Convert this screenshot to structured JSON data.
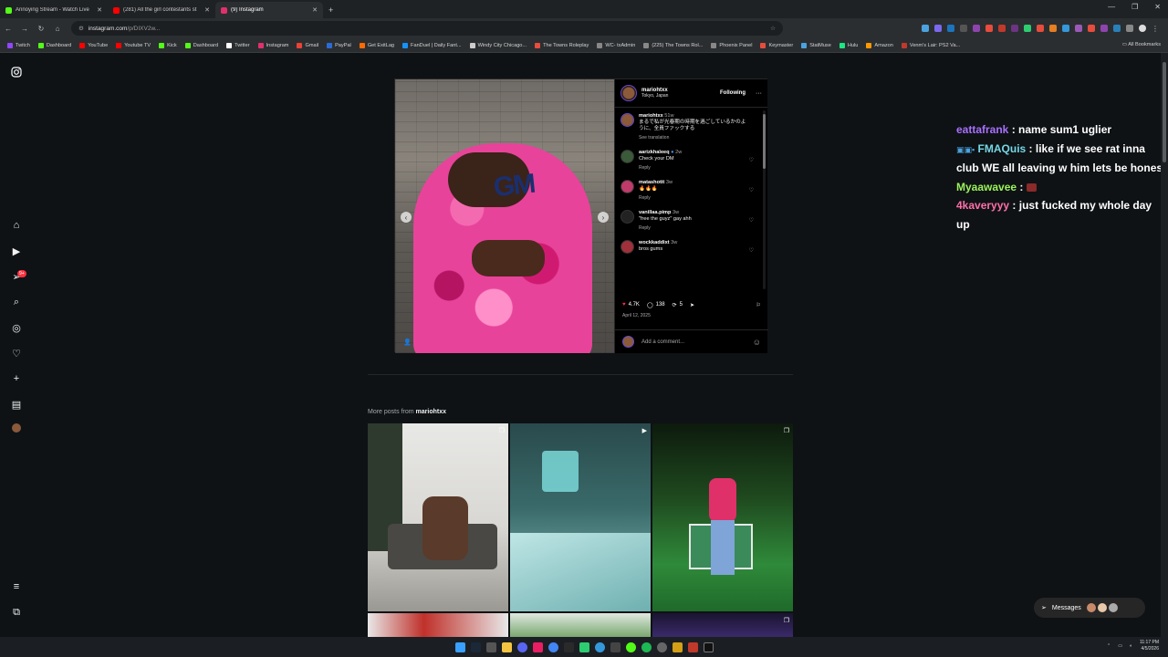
{
  "browser": {
    "tabs": [
      {
        "title": "Annoying Stream - Watch Live",
        "color": "#53fc18"
      },
      {
        "title": "(281) All the girl contestants st",
        "color": "#ff0000"
      },
      {
        "title": "(9) Instagram",
        "color": "#e1306c"
      }
    ],
    "url_host": "instagram.com",
    "url_path": "/p/DIXV2w..."
  },
  "bookmarks": [
    {
      "label": "Twitch",
      "color": "#9146ff"
    },
    {
      "label": "Dashboard",
      "color": "#53fc18"
    },
    {
      "label": "YouTube",
      "color": "#ff0000"
    },
    {
      "label": "Youtube TV",
      "color": "#ff0000"
    },
    {
      "label": "Kick",
      "color": "#53fc18"
    },
    {
      "label": "Dashboard",
      "color": "#53fc18"
    },
    {
      "label": "Twitter",
      "color": "#ffffff"
    },
    {
      "label": "Instagram",
      "color": "#e1306c"
    },
    {
      "label": "Gmail",
      "color": "#ea4335"
    },
    {
      "label": "PayPal",
      "color": "#2b6bd8"
    },
    {
      "label": "Get ExitLag",
      "color": "#ff6a00"
    },
    {
      "label": "FanDuel | Daily Fant...",
      "color": "#1493ff"
    },
    {
      "label": "Windy City Chicago...",
      "color": "#cccccc"
    },
    {
      "label": "The Towns Roleplay",
      "color": "#e74c3c"
    },
    {
      "label": "WC- txAdmin",
      "color": "#888888"
    },
    {
      "label": "(225) The Towns Rol...",
      "color": "#888888"
    },
    {
      "label": "Phoenix Panel",
      "color": "#888888"
    },
    {
      "label": "Keymaster",
      "color": "#e74c3c"
    },
    {
      "label": "StatMuse",
      "color": "#4aa3df"
    },
    {
      "label": "Hulu",
      "color": "#1ce783"
    },
    {
      "label": "Amazon",
      "color": "#ff9900"
    },
    {
      "label": "Venm's Lair: PS2 Va...",
      "color": "#c0392b"
    }
  ],
  "all_bookmarks": "All Bookmarks",
  "sidebar": {
    "notification_count": "9+"
  },
  "post": {
    "username": "mariohtxx",
    "location": "Tokyo, Japan",
    "follow_label": "Following",
    "caption_user": "mariohtxx",
    "caption_age": "51w",
    "caption_text": "まるで私が光春期の時期を過ごしているかのように、全員ファックする",
    "see_translation": "See translation",
    "comments": [
      {
        "user": "aarizkhaleeq",
        "age": "2w",
        "text": "Check your DM"
      },
      {
        "user": "matashotit",
        "age": "3w",
        "text": "🔥🔥🔥"
      },
      {
        "user": "vanillaa.pimp",
        "age": "3w",
        "text": "\"free the guyz\" gay ahh"
      },
      {
        "user": "wockkaddixt",
        "age": "3w",
        "text": "bros gums"
      }
    ],
    "reply_label": "Reply",
    "likes": "4.7K",
    "comments_count": "138",
    "reposts": "5",
    "date": "April 12, 2025",
    "add_comment_placeholder": "Add a comment..."
  },
  "more_posts": {
    "prefix": "More posts from",
    "user": "mariohtxx"
  },
  "chat": [
    {
      "name": "eattafrank",
      "text": "name sum1 uglier"
    },
    {
      "name": "FMAQuis",
      "text": "like if we see rat inna club WE all leaving w him lets be honest"
    },
    {
      "name": "Myaawavee",
      "text": ""
    },
    {
      "name": "4kaveryyy",
      "text": "just fucked my whole day up"
    }
  ],
  "messages_label": "Messages",
  "clock": {
    "time": "11:17 PM",
    "date": "4/5/2026"
  }
}
